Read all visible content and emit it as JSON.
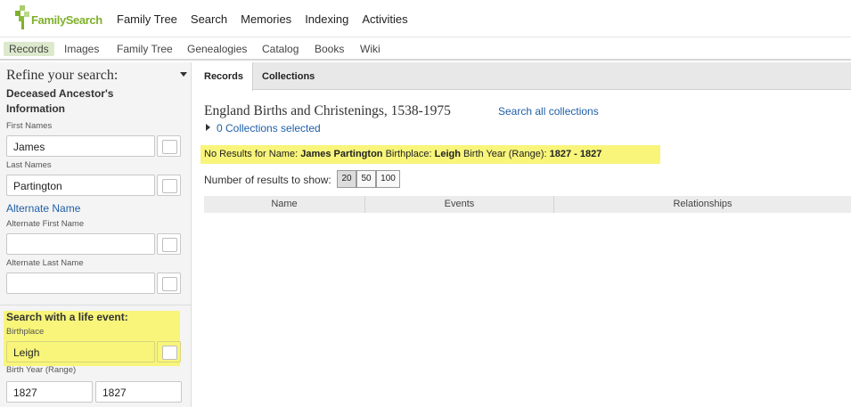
{
  "header": {
    "logo_text": "FamilySearch",
    "nav": [
      "Family Tree",
      "Search",
      "Memories",
      "Indexing",
      "Activities"
    ]
  },
  "subnav": {
    "items": [
      "Records",
      "Images",
      "Family Tree",
      "Genealogies",
      "Catalog",
      "Books",
      "Wiki"
    ],
    "active": "Records"
  },
  "sidebar": {
    "refine_title": "Refine your search:",
    "section_ancestor": "Deceased Ancestor's Information",
    "first_names_label": "First Names",
    "first_names_value": "James",
    "last_names_label": "Last Names",
    "last_names_value": "Partington",
    "alternate_name_link": "Alternate Name",
    "alt_first_label": "Alternate First Name",
    "alt_first_value": "",
    "alt_last_label": "Alternate Last Name",
    "alt_last_value": "",
    "life_event_title": "Search with a life event:",
    "birthplace_label": "Birthplace",
    "birthplace_value": "Leigh",
    "birth_year_label": "Birth Year (Range)",
    "birth_year_from": "1827",
    "birth_year_to": "1827"
  },
  "main": {
    "tabs": [
      "Records",
      "Collections"
    ],
    "active_tab": "Records",
    "collection_title": "England Births and Christenings, 1538-1975",
    "search_all_link": "Search all collections",
    "collections_selected": "0 Collections selected",
    "no_results": {
      "prefix": "No Results for Name: ",
      "name": "James Partington",
      "birthplace_label": " Birthplace: ",
      "birthplace": "Leigh",
      "birth_year_label": " Birth Year (Range): ",
      "birth_year": "1827 - 1827"
    },
    "num_results_label": "Number of results to show:",
    "num_options": [
      "20",
      "50",
      "100"
    ],
    "num_selected": "20",
    "table_columns": [
      "Name",
      "Events",
      "Relationships"
    ]
  },
  "colors": {
    "brand_green": "#7fb02b",
    "link_blue": "#2060a8",
    "highlight_yellow": "#f8f57a",
    "active_subnav": "#dde9cc"
  }
}
